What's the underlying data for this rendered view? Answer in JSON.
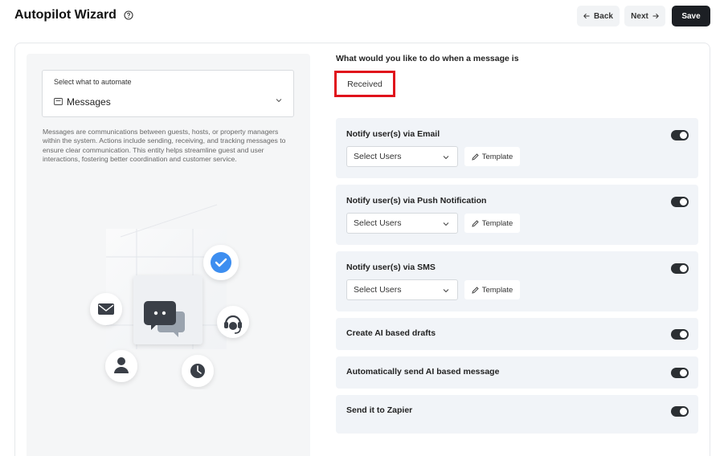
{
  "header": {
    "title": "Autopilot Wizard",
    "back_label": "Back",
    "next_label": "Next",
    "save_label": "Save"
  },
  "left": {
    "select_label": "Select what to automate",
    "select_value": "Messages",
    "description": "Messages are communications between guests, hosts, or property managers within the system. Actions include sending, receiving, and tracking messages to ensure clear communication. This entity helps streamline guest and user interactions, fostering better coordination and customer service."
  },
  "right": {
    "question": "What would you like to do when a message is",
    "trigger_value": "Received",
    "options": [
      {
        "title": "Notify user(s) via Email",
        "enabled": true,
        "select_placeholder": "Select Users",
        "template_label": "Template"
      },
      {
        "title": "Notify user(s) via Push Notification",
        "enabled": true,
        "select_placeholder": "Select Users",
        "template_label": "Template"
      },
      {
        "title": "Notify user(s) via SMS",
        "enabled": true,
        "select_placeholder": "Select Users",
        "template_label": "Template"
      },
      {
        "title": "Create AI based drafts",
        "enabled": true
      },
      {
        "title": "Automatically send AI based message",
        "enabled": true
      },
      {
        "title": "Send it to Zapier",
        "enabled": true
      }
    ]
  },
  "colors": {
    "accent": "#1c1f24",
    "highlight_border": "#e0121b",
    "check_blue": "#3d8ef0",
    "card_bg": "#f1f4f8"
  },
  "icons": [
    "help-circle-icon",
    "arrow-left-icon",
    "arrow-right-icon",
    "mail-icon",
    "chevron-down-icon",
    "pencil-icon",
    "check-circle-icon",
    "chat-bubbles-icon",
    "headset-icon",
    "user-icon",
    "clock-icon"
  ]
}
